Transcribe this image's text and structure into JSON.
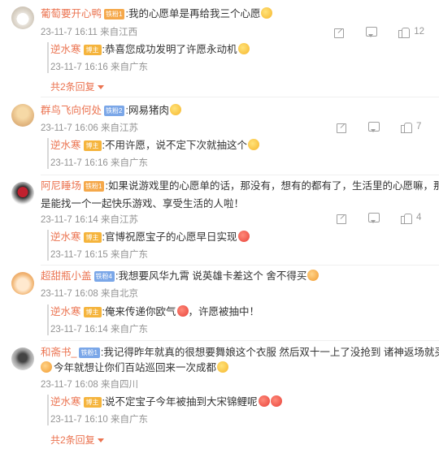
{
  "colors": {
    "username": "#eb7350",
    "meta": "#939393",
    "gold_badge": "#f5a84a",
    "blue_badge": "#7ba7e8"
  },
  "comments": [
    {
      "user": "葡萄要开心鸭",
      "badge": "铁粉1",
      "badge_style": "gold",
      "text": ":我的心愿单是再给我三个心愿",
      "meta": "23-11-7 16:11 来自江西",
      "likes": "12",
      "replies": [
        {
          "user": "逆水寒",
          "role": "博主",
          "text": ":恭喜您成功发明了许愿永动机",
          "meta": "23-11-7 16:16 来自广东"
        }
      ],
      "more": "共2条回复"
    },
    {
      "user": "群鸟飞向何处",
      "badge": "铁粉2",
      "badge_style": "blue",
      "text": ":网易猪肉",
      "meta": "23-11-7 16:06 来自江苏",
      "likes": "7",
      "replies": [
        {
          "user": "逆水寒",
          "role": "博主",
          "text": ":不用许愿，说不定下次就抽这个",
          "meta": "23-11-7 16:16 来自广东"
        }
      ]
    },
    {
      "user": "阿尼睡场",
      "badge": "铁粉1",
      "badge_style": "gold",
      "text": ":如果说游戏里的心愿单的话，那没有，想有的都有了，生活里的心愿嘛，那就",
      "text2": "是能找一个一起快乐游戏、享受生活的人啦！",
      "meta": "23-11-7 16:14 来自江苏",
      "likes": "4",
      "replies": [
        {
          "user": "逆水寒",
          "role": "博主",
          "text": ":官博祝愿宝子的心愿早日实现",
          "meta": "23-11-7 16:15 来自广东"
        }
      ]
    },
    {
      "user": "超甜瓶小盖",
      "badge": "铁粉4",
      "badge_style": "blue",
      "text": ":我想要风华九霄 说英雄卡差这个 舍不得买",
      "meta": "23-11-7 16:08 来自北京",
      "likes": "",
      "replies": [
        {
          "user": "逆水寒",
          "role": "博主",
          "text": ":俺来传递你欧气",
          "text_tail": "，许愿被抽中！",
          "meta": "23-11-7 16:14 来自广东"
        }
      ]
    },
    {
      "user": "和斋书_",
      "badge": "铁粉1",
      "badge_style": "blue",
      "text": ":我记得昨年就真的很想要舞娘这个衣服 然后双十一上了没抢到 诸神返场就买了",
      "text2": "今年就想让你们百站巡回来一次成都",
      "meta": "23-11-7 16:08 来自四川",
      "likes": "",
      "replies": [
        {
          "user": "逆水寒",
          "role": "博主",
          "text": ":说不定宝子今年被抽到大宋锦鲤呢",
          "meta": "23-11-7 16:10 来自广东"
        }
      ],
      "more": "共2条回复"
    }
  ]
}
